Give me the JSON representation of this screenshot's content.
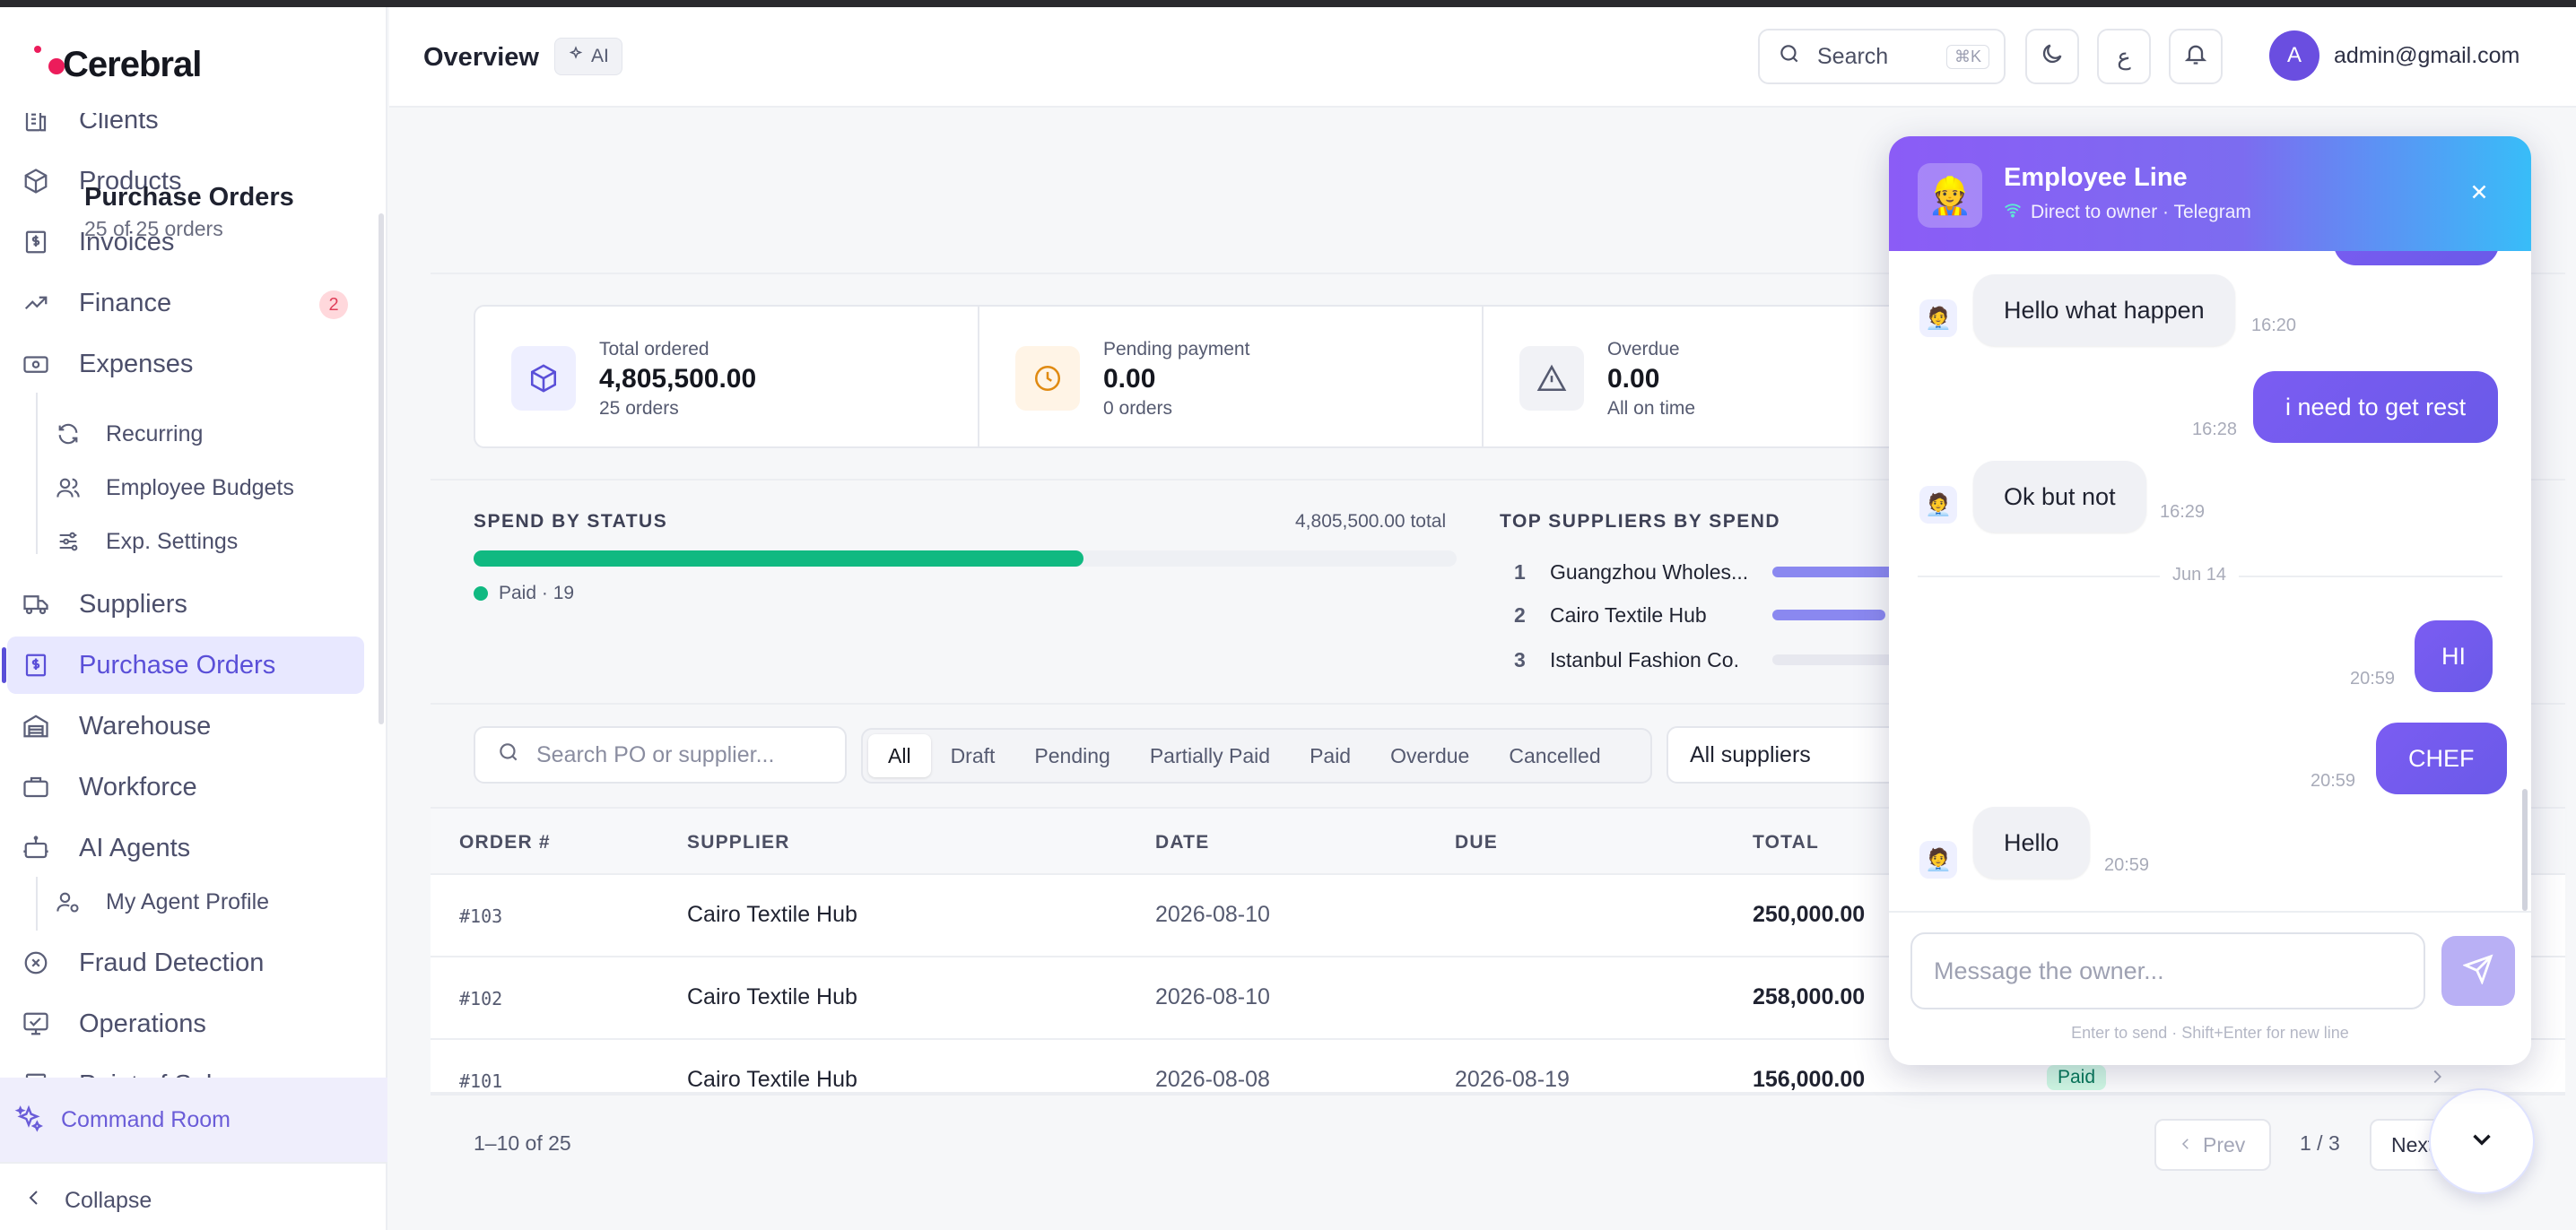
{
  "app": {
    "brand": "Cerebral",
    "colors": {
      "accent": "#5a4fd8",
      "success": "#10b981",
      "danger": "#ec1c5b",
      "chat_gradient_start": "#8b5cf6",
      "chat_gradient_end": "#38bdf8"
    }
  },
  "sidebar": {
    "items": [
      {
        "label": "Clients",
        "icon": "building-icon"
      },
      {
        "label": "Products",
        "icon": "box-icon"
      },
      {
        "label": "Invoices",
        "icon": "invoice-icon"
      },
      {
        "label": "Finance",
        "icon": "trend-icon",
        "badge": "2"
      },
      {
        "label": "Expenses",
        "icon": "wallet-icon"
      },
      {
        "label": "Recurring",
        "icon": "refresh-icon"
      },
      {
        "label": "Employee Budgets",
        "icon": "users-icon"
      },
      {
        "label": "Exp. Settings",
        "icon": "sliders-icon"
      },
      {
        "label": "Suppliers",
        "icon": "truck-icon"
      },
      {
        "label": "Purchase Orders",
        "icon": "receipt-icon"
      },
      {
        "label": "Warehouse",
        "icon": "warehouse-icon"
      },
      {
        "label": "Workforce",
        "icon": "briefcase-icon"
      },
      {
        "label": "AI Agents",
        "icon": "bot-icon"
      },
      {
        "label": "My Agent Profile",
        "icon": "user-cog-icon"
      },
      {
        "label": "Fraud Detection",
        "icon": "scan-icon"
      },
      {
        "label": "Operations",
        "icon": "monitor-icon"
      },
      {
        "label": "Point of Sale",
        "icon": "pos-icon"
      }
    ],
    "command_room": "Command Room",
    "collapse": "Collapse"
  },
  "header": {
    "title": "Overview",
    "ai_chip": "AI",
    "search_label": "Search",
    "search_shortcut": "⌘K",
    "lang_toggle": "ع",
    "user_initial": "A",
    "user_email": "admin@gmail.com"
  },
  "purchase_orders": {
    "title": "Purchase Orders",
    "subtitle": "25 of 25 orders",
    "stats": [
      {
        "label": "Total ordered",
        "value": "4,805,500.00",
        "sub": "25 orders",
        "icon": "box-icon"
      },
      {
        "label": "Pending payment",
        "value": "0.00",
        "sub": "0 orders",
        "icon": "clock-icon"
      },
      {
        "label": "Overdue",
        "value": "0.00",
        "sub": "All on time",
        "icon": "warning-icon"
      }
    ],
    "spend_by_status": {
      "label": "SPEND BY STATUS",
      "total": "4,805,500.00 total",
      "paid_fraction": 0.62,
      "legend": "Paid · 19"
    },
    "top_suppliers": {
      "label": "TOP SUPPLIERS BY SPEND",
      "items": [
        {
          "rank": "1",
          "name": "Guangzhou Wholes...",
          "share": 1.0
        },
        {
          "rank": "2",
          "name": "Cairo Textile Hub",
          "share": 0.9
        },
        {
          "rank": "3",
          "name": "Istanbul Fashion Co.",
          "share": 0.25
        }
      ]
    },
    "search_placeholder": "Search PO or supplier...",
    "filters": [
      "All",
      "Draft",
      "Pending",
      "Partially Paid",
      "Paid",
      "Overdue",
      "Cancelled"
    ],
    "active_filter": "All",
    "supplier_select": "All suppliers",
    "columns": [
      "ORDER #",
      "SUPPLIER",
      "DATE",
      "DUE",
      "TOTAL"
    ],
    "rows": [
      {
        "order": "#103",
        "supplier": "Cairo Textile Hub",
        "date": "2026-08-10",
        "due": "",
        "total": "250,000.00",
        "status": ""
      },
      {
        "order": "#102",
        "supplier": "Cairo Textile Hub",
        "date": "2026-08-10",
        "due": "",
        "total": "258,000.00",
        "status": ""
      },
      {
        "order": "#101",
        "supplier": "Cairo Textile Hub",
        "date": "2026-08-08",
        "due": "2026-08-19",
        "total": "156,000.00",
        "status": "Paid"
      }
    ],
    "pagination": {
      "range": "1–10 of 25",
      "prev": "Prev",
      "page": "1 / 3",
      "next": "Next"
    }
  },
  "chat": {
    "title": "Employee Line",
    "subtitle": "Direct to owner · Telegram",
    "messages": [
      {
        "dir": "in",
        "text": "Hello what happen",
        "time": "16:20"
      },
      {
        "dir": "out",
        "text": "i need to get rest",
        "time": "16:28"
      },
      {
        "dir": "in",
        "text": "Ok but not",
        "time": "16:29"
      },
      {
        "dir": "sep",
        "text": "Jun 14"
      },
      {
        "dir": "out",
        "text": "HI",
        "time": "20:59"
      },
      {
        "dir": "out",
        "text": "CHEF",
        "time": "20:59"
      },
      {
        "dir": "in",
        "text": "Hello",
        "time": "20:59"
      }
    ],
    "input_placeholder": "Message the owner...",
    "hint": "Enter to send · Shift+Enter for new line"
  }
}
